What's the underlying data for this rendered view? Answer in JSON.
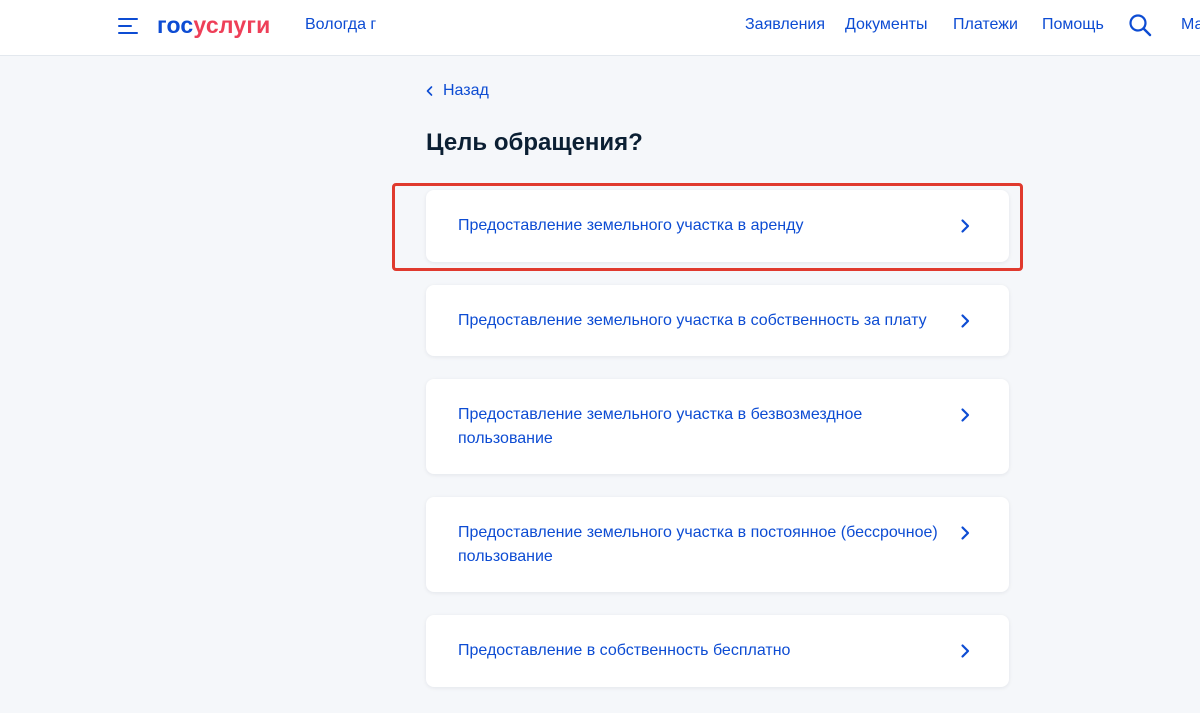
{
  "header": {
    "logo_part1": "гос",
    "logo_part2": "услуги",
    "region": "Вологда г",
    "nav": [
      {
        "label": "Заявления"
      },
      {
        "label": "Документы"
      },
      {
        "label": "Платежи"
      },
      {
        "label": "Помощь"
      }
    ],
    "profile_label": "Ма"
  },
  "main": {
    "back_label": "Назад",
    "title": "Цель обращения?",
    "options": [
      {
        "label": "Предоставление земельного участка в аренду"
      },
      {
        "label": "Предоставление земельного участка в собственность за плату"
      },
      {
        "label": "Предоставление земельного участка в безвозмездное пользование"
      },
      {
        "label": "Предоставление земельного участка в постоянное (бессрочное) пользование"
      },
      {
        "label": "Предоставление в собственность бесплатно"
      }
    ]
  },
  "icons": {
    "menu": "menu-icon",
    "search": "search-icon",
    "back": "chevron-left-icon",
    "option_arrow": "chevron-right-icon"
  },
  "colors": {
    "brand_blue": "#0d4cd3",
    "brand_red": "#ee3f58",
    "title_text": "#0b1f33",
    "page_bg": "#f5f7fa",
    "highlight_red": "#e03a2e"
  }
}
